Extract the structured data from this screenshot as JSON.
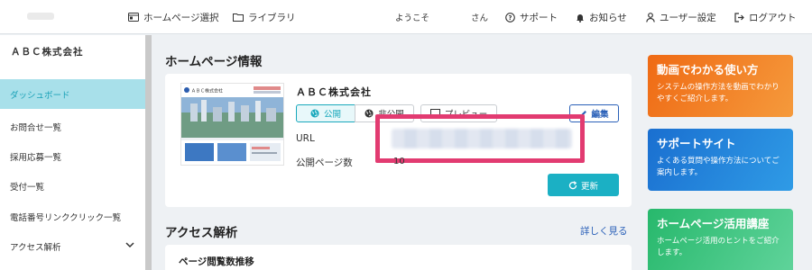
{
  "topbar": {
    "homepage_select": "ホームページ選択",
    "library": "ライブラリ",
    "welcome": "ようこそ",
    "san": "さん",
    "support": "サポート",
    "notices": "お知らせ",
    "user_settings": "ユーザー設定",
    "logout": "ログアウト"
  },
  "sidebar": {
    "company": "ＡＢＣ株式会社",
    "items": [
      {
        "label": "ダッシュボード"
      },
      {
        "label": "お問合せ一覧"
      },
      {
        "label": "採用応募一覧"
      },
      {
        "label": "受付一覧"
      },
      {
        "label": "電話番号リンククリック一覧"
      },
      {
        "label": "アクセス解析"
      }
    ]
  },
  "homepage_info": {
    "title": "ホームページ情報",
    "site_name": "ＡＢＣ株式会社",
    "thumb_site_name": "ＡＢＣ株式会社",
    "status_public": "公開",
    "status_private": "非公開",
    "preview": "プレビュー",
    "edit": "編集",
    "url_label": "URL",
    "pages_label": "公開ページ数",
    "pages_value": "10",
    "update": "更新"
  },
  "access": {
    "title": "アクセス解析",
    "more": "詳しく見る",
    "subtitle": "ページ閲覧数推移"
  },
  "promos": [
    {
      "title": "動画でわかる使い方",
      "text": "システムの操作方法を動画でわかりやすくご紹介します。",
      "color": "#f07a1e"
    },
    {
      "title": "サポートサイト",
      "text": "よくある質問や操作方法についてご案内します。",
      "color": "#1c7fd6"
    },
    {
      "title": "ホームページ活用講座",
      "text": "ホームページ活用のヒントをご紹介します。",
      "color": "#2fc07a"
    }
  ]
}
